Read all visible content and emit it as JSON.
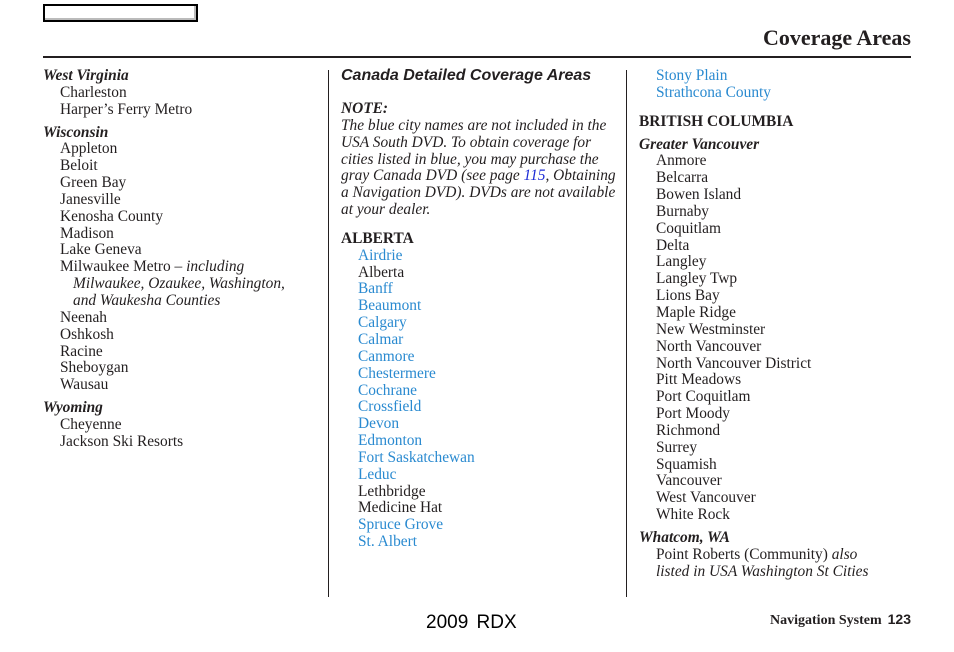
{
  "header": {
    "title": "Coverage Areas"
  },
  "column1": {
    "regions": [
      {
        "name": "West Virginia",
        "cities": [
          "Charleston",
          "Harper’s Ferry Metro"
        ]
      },
      {
        "name": "Wisconsin",
        "cities": [
          "Appleton",
          "Beloit",
          "Green Bay",
          "Janesville",
          "Kenosha County",
          "Madison",
          "Lake Geneva"
        ],
        "milwaukee": {
          "city": "Milwaukee Metro – ",
          "note": "including",
          "cont1": "Milwaukee, Ozaukee, Washington,",
          "cont2": "and Waukesha Counties"
        },
        "cities_after": [
          "Neenah",
          "Oshkosh",
          "Racine",
          "Sheboygan",
          "Wausau"
        ]
      },
      {
        "name": "Wyoming",
        "cities": [
          "Cheyenne",
          "Jackson Ski Resorts"
        ]
      }
    ]
  },
  "column2": {
    "section_title": "Canada Detailed Coverage Areas",
    "note_label": "NOTE:",
    "note_text_before": "The blue city names are not included in the USA South DVD. To obtain coverage for cities listed in blue, you may purchase the gray Canada DVD (see page ",
    "note_page_link": "115",
    "note_text_after": ", Obtaining a Navigation DVD). DVDs are not available at your dealer.",
    "province": "ALBERTA",
    "cities": [
      {
        "name": "Airdrie",
        "blue": true
      },
      {
        "name": "Alberta",
        "blue": false
      },
      {
        "name": "Banff",
        "blue": true
      },
      {
        "name": "Beaumont",
        "blue": true
      },
      {
        "name": "Calgary",
        "blue": true
      },
      {
        "name": "Calmar",
        "blue": true
      },
      {
        "name": "Canmore",
        "blue": true
      },
      {
        "name": "Chestermere",
        "blue": true
      },
      {
        "name": "Cochrane",
        "blue": true
      },
      {
        "name": "Crossfield",
        "blue": true
      },
      {
        "name": "Devon",
        "blue": true
      },
      {
        "name": "Edmonton",
        "blue": true
      },
      {
        "name": "Fort Saskatchewan",
        "blue": true
      },
      {
        "name": "Leduc",
        "blue": true
      },
      {
        "name": "Lethbridge",
        "blue": false
      },
      {
        "name": "Medicine Hat",
        "blue": false
      },
      {
        "name": "Spruce Grove",
        "blue": true
      },
      {
        "name": "St. Albert",
        "blue": true
      }
    ]
  },
  "column3": {
    "alberta_continued": [
      {
        "name": "Stony Plain",
        "blue": true
      },
      {
        "name": "Strathcona County",
        "blue": true
      }
    ],
    "province": "BRITISH COLUMBIA",
    "greater_vancouver": {
      "name": "Greater Vancouver",
      "cities": [
        "Anmore",
        "Belcarra",
        "Bowen Island",
        "Burnaby",
        "Coquitlam",
        "Delta",
        "Langley",
        "Langley Twp",
        "Lions Bay",
        "Maple Ridge",
        "New Westminster",
        "North Vancouver",
        "North Vancouver District",
        "Pitt Meadows",
        "Port Coquitlam",
        "Port Moody",
        "Richmond",
        "Surrey",
        "Squamish",
        "Vancouver",
        "West Vancouver",
        "White Rock"
      ]
    },
    "whatcom": {
      "name": "Whatcom, WA",
      "city": "Point Roberts (Community) ",
      "note1": "also",
      "note2": "listed in USA Washington St Cities"
    }
  },
  "footer": {
    "model": "2009  RDX",
    "section": "Navigation System",
    "page_number": "123"
  },
  "colors": {
    "blue_city": "#2a8ad0",
    "page_link": "#1c2bd6",
    "text": "#231f20"
  }
}
